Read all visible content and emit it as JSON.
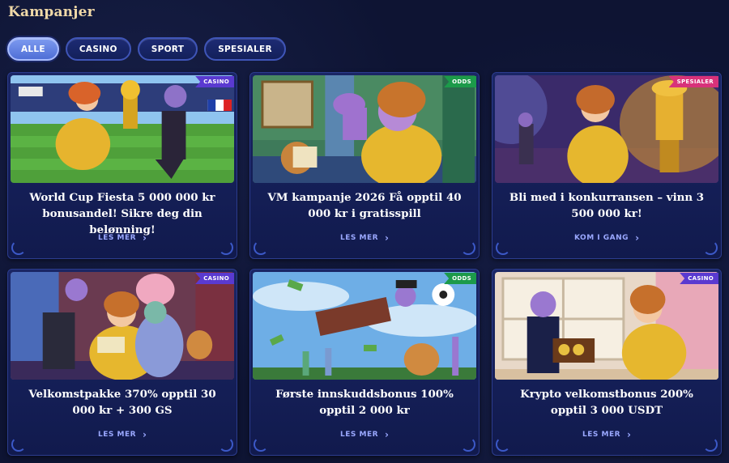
{
  "page": {
    "title": "Kampanjer"
  },
  "filters": [
    {
      "label": "ALLE",
      "active": true
    },
    {
      "label": "CASINO",
      "active": false
    },
    {
      "label": "SPORT",
      "active": false
    },
    {
      "label": "SPESIALER",
      "active": false
    }
  ],
  "cards": [
    {
      "badge": "CASINO",
      "title": "World Cup Fiesta 5 000 000 kr bonusandel! Sikre deg din belønning!",
      "cta": "LES MER"
    },
    {
      "badge": "ODDS",
      "title": "VM kampanje 2026 Få opptil 40 000 kr i gratisspill",
      "cta": "LES MER"
    },
    {
      "badge": "SPESIALER",
      "title": "Bli med i konkurransen – vinn 3 500 000 kr!",
      "cta": "KOM I GANG"
    },
    {
      "badge": "CASINO",
      "title": "Velkomstpakke 370% opptil 30 000 kr + 300 GS",
      "cta": "LES MER"
    },
    {
      "badge": "ODDS",
      "title": "Første innskuddsbonus 100% opptil 2 000 kr",
      "cta": "LES MER"
    },
    {
      "badge": "CASINO",
      "title": "Krypto velkomstbonus 200% opptil 3 000 USDT",
      "cta": "LES MER"
    }
  ],
  "icons": {
    "link_arrow": "chevron-right-icon"
  },
  "colors": {
    "accent": "#9aa8ff",
    "title": "#f0d9a8",
    "casino": "#5a3ad0",
    "odds": "#1c9a4a",
    "spesialer": "#d8327a"
  }
}
